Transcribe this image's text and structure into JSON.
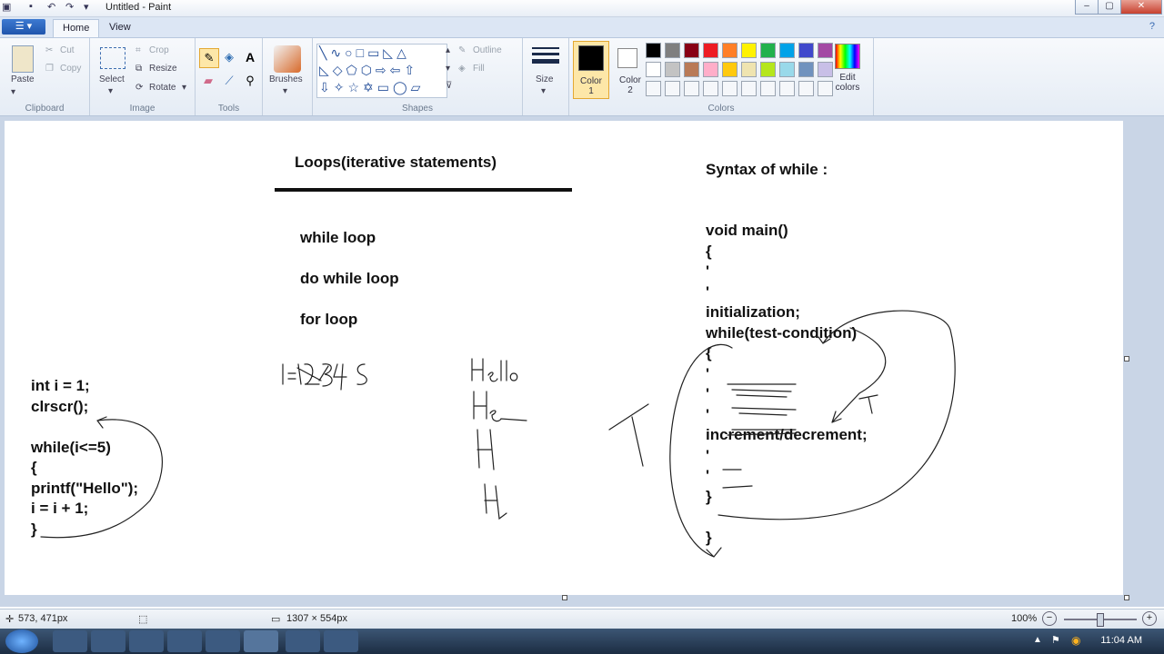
{
  "window": {
    "title": "Untitled - Paint"
  },
  "tabs": [
    {
      "label": "Home"
    },
    {
      "label": "View"
    }
  ],
  "ribbon": {
    "clipboard": {
      "paste": "Paste",
      "cut": "Cut",
      "copy": "Copy",
      "label": "Clipboard"
    },
    "image": {
      "select": "Select",
      "crop": "Crop",
      "resize": "Resize",
      "rotate": "Rotate",
      "label": "Image"
    },
    "tools": {
      "label": "Tools"
    },
    "brushes": {
      "label": "Brushes"
    },
    "shapes": {
      "outline": "Outline",
      "fill": "Fill",
      "label": "Shapes"
    },
    "size": {
      "label": "Size"
    },
    "colors": {
      "color1_line1": "Color",
      "color1_line2": "1",
      "color2_line1": "Color",
      "color2_line2": "2",
      "edit_line1": "Edit",
      "edit_line2": "colors",
      "label": "Colors",
      "color1": "#000000",
      "color2": "#ffffff",
      "palette_row1": [
        "#000000",
        "#7f7f7f",
        "#880015",
        "#ed1c24",
        "#ff7f27",
        "#fff200",
        "#22b14c",
        "#00a2e8",
        "#3f48cc",
        "#a349a4"
      ],
      "palette_row2": [
        "#ffffff",
        "#c3c3c3",
        "#b97a57",
        "#ffaec9",
        "#ffc90e",
        "#efe4b0",
        "#b5e61d",
        "#99d9ea",
        "#7092be",
        "#c8bfe7"
      ]
    }
  },
  "canvas": {
    "heading": "Loops(iterative statements)",
    "loops": [
      "while loop",
      "do while loop",
      "for loop"
    ],
    "syntax_title": "Syntax of while :",
    "syntax_lines": [
      "void main()",
      "{",
      "'",
      "'",
      "initialization;",
      "while(test-condition)",
      "{",
      "'",
      "'",
      "'",
      "increment/decrement;",
      "'",
      "'",
      "}",
      "",
      "}"
    ],
    "code_lines": [
      "int i = 1;",
      "clrscr();",
      "",
      "while(i<=5)",
      "{",
      "printf(\"Hello\");",
      "i = i + 1;",
      "}"
    ]
  },
  "status": {
    "cursor_pos": "573, 471px",
    "canvas_size": "1307 × 554px",
    "zoom": "100%"
  },
  "taskbar": {
    "time": "11:04 AM"
  }
}
